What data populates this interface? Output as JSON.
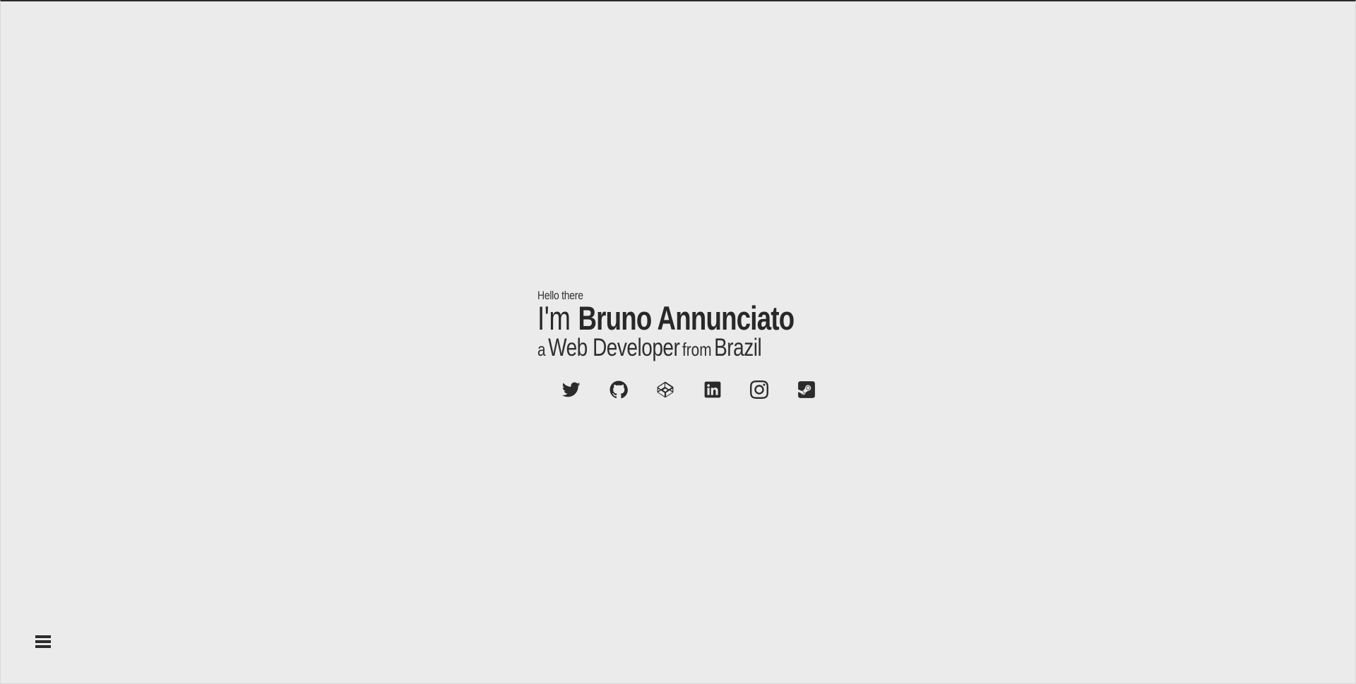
{
  "intro": {
    "greeting": "Hello there",
    "prefix": "I'm",
    "name": "Bruno Annunciato",
    "article": "a",
    "role": "Web Developer",
    "from": "from",
    "place": "Brazil"
  },
  "social": [
    {
      "icon": "twitter-icon"
    },
    {
      "icon": "github-icon"
    },
    {
      "icon": "codepen-icon"
    },
    {
      "icon": "linkedin-icon"
    },
    {
      "icon": "instagram-icon"
    },
    {
      "icon": "steam-icon"
    }
  ],
  "menu": {
    "icon": "hamburger-menu-icon"
  },
  "colors": {
    "background": "#ebebeb",
    "text": "#2b2b2b"
  }
}
